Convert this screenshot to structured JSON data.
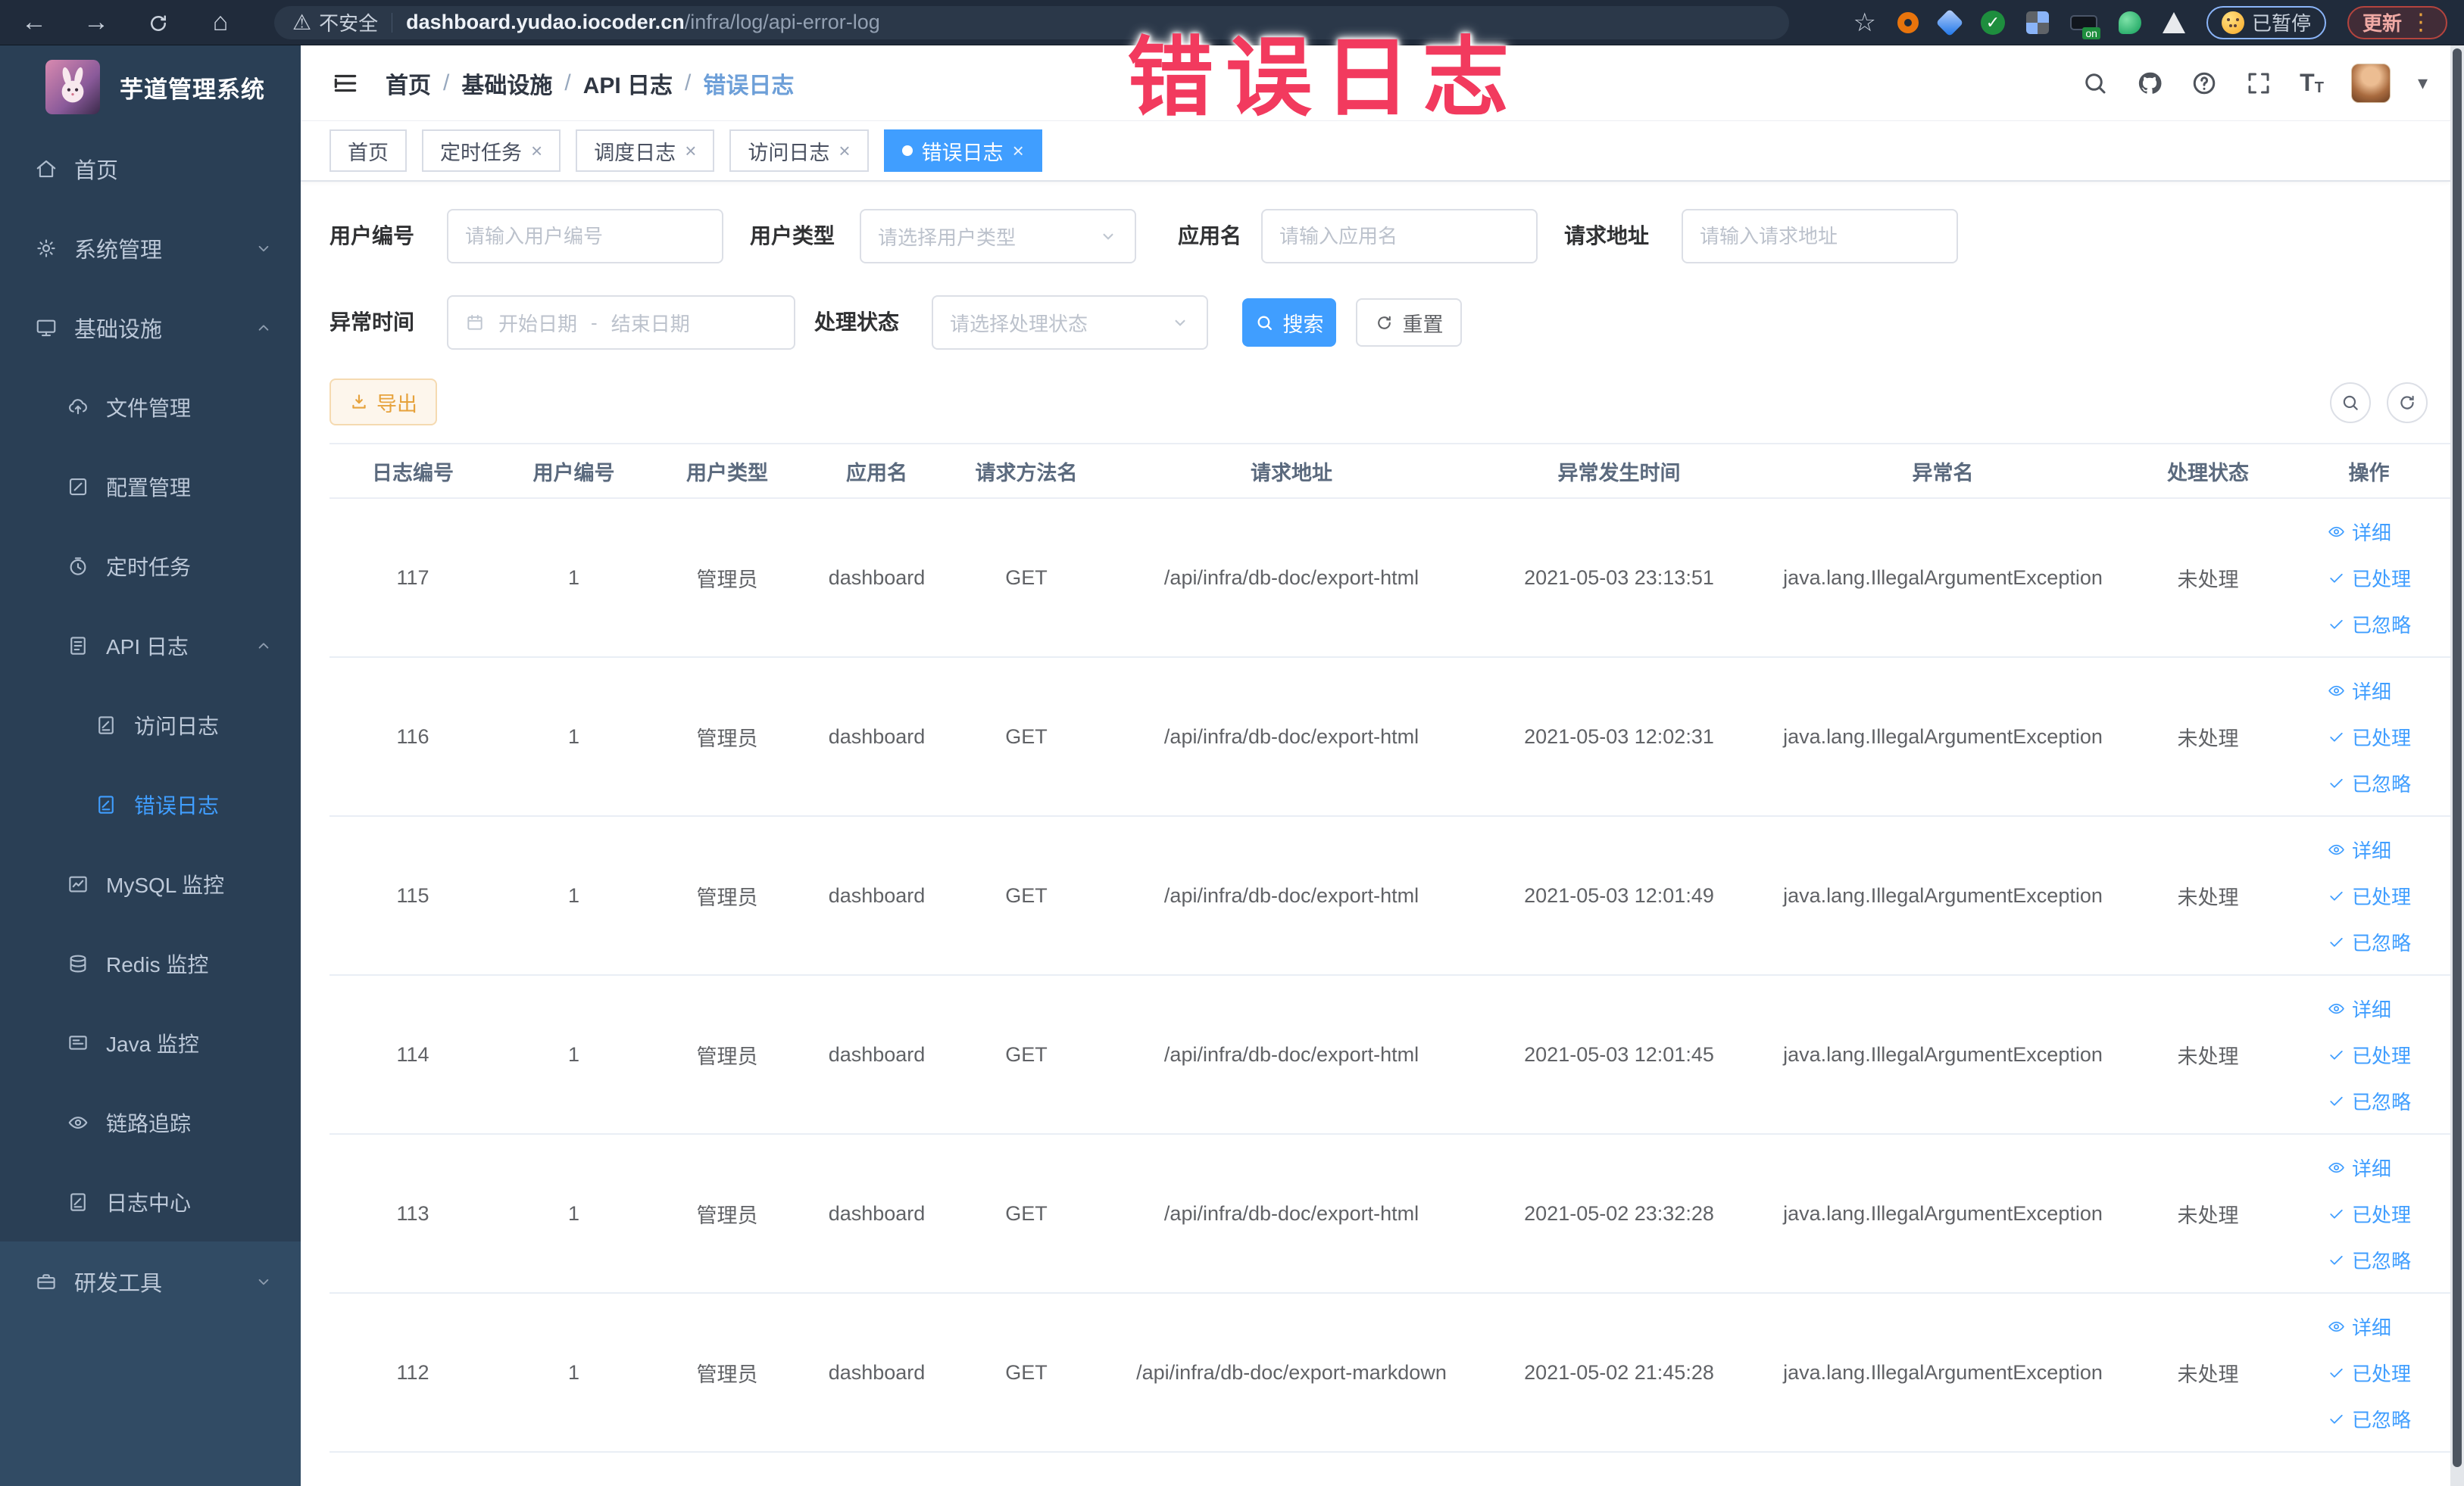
{
  "colors": {
    "accent": "#409eff",
    "warning": "#e6a23c",
    "overlay": "#f23a5e",
    "sidebar_bg": "#2a3f55",
    "active_tab_bg": "#409eff"
  },
  "overlay_title": "错误日志",
  "browser": {
    "security_label": "不安全",
    "url_host": "dashboard.yudao.iocoder.cn",
    "url_path": "/infra/log/api-error-log",
    "ext_on_label": "on",
    "paused_badge": "已暂停",
    "update_label": "更新"
  },
  "sidebar": {
    "title": "芋道管理系统",
    "items": [
      {
        "key": "home",
        "label": "首页",
        "icon": "home",
        "level": 0
      },
      {
        "key": "system-management",
        "label": "系统管理",
        "icon": "gear",
        "level": 0,
        "chevron": "down"
      },
      {
        "key": "infrastructure",
        "label": "基础设施",
        "icon": "monitor",
        "level": 0,
        "chevron": "up"
      },
      {
        "key": "file-management",
        "label": "文件管理",
        "icon": "cloud",
        "level": 1
      },
      {
        "key": "config-management",
        "label": "配置管理",
        "icon": "edit",
        "level": 1
      },
      {
        "key": "scheduled-jobs",
        "label": "定时任务",
        "icon": "timer",
        "level": 1
      },
      {
        "key": "api-log",
        "label": "API 日志",
        "icon": "doc",
        "level": 1,
        "chevron": "up"
      },
      {
        "key": "access-log",
        "label": "访问日志",
        "icon": "doc-edit",
        "level": 2
      },
      {
        "key": "error-log",
        "label": "错误日志",
        "icon": "doc-edit",
        "level": 2,
        "active": true
      },
      {
        "key": "mysql-monitor",
        "label": "MySQL 监控",
        "icon": "chart",
        "level": 1
      },
      {
        "key": "redis-monitor",
        "label": "Redis 监控",
        "icon": "db",
        "level": 1
      },
      {
        "key": "java-monitor",
        "label": "Java 监控",
        "icon": "screen",
        "level": 1
      },
      {
        "key": "trace",
        "label": "链路追踪",
        "icon": "eye",
        "level": 1
      },
      {
        "key": "log-center",
        "label": "日志中心",
        "icon": "doc-edit",
        "level": 1
      },
      {
        "key": "dev-tools",
        "label": "研发工具",
        "icon": "toolbox",
        "level": 0,
        "chevron": "down",
        "section": "dev"
      }
    ]
  },
  "header": {
    "breadcrumb": [
      "首页",
      "基础设施",
      "API 日志",
      "错误日志"
    ]
  },
  "tabs": [
    {
      "key": "home",
      "label": "首页"
    },
    {
      "key": "job",
      "label": "定时任务",
      "closable": true
    },
    {
      "key": "job-log",
      "label": "调度日志",
      "closable": true
    },
    {
      "key": "access-log",
      "label": "访问日志",
      "closable": true
    },
    {
      "key": "error-log",
      "label": "错误日志",
      "closable": true,
      "active": true
    }
  ],
  "filters": {
    "user_id_label": "用户编号",
    "user_id_placeholder": "请输入用户编号",
    "user_type_label": "用户类型",
    "user_type_placeholder": "请选择用户类型",
    "app_name_label": "应用名",
    "app_name_placeholder": "请输入应用名",
    "request_url_label": "请求地址",
    "request_url_placeholder": "请输入请求地址",
    "exception_time_label": "异常时间",
    "date_start_placeholder": "开始日期",
    "range_separator": "-",
    "date_end_placeholder": "结束日期",
    "process_status_label": "处理状态",
    "process_status_placeholder": "请选择处理状态",
    "search_label": "搜索",
    "reset_label": "重置"
  },
  "toolbar": {
    "export_label": "导出"
  },
  "table": {
    "columns": [
      "日志编号",
      "用户编号",
      "用户类型",
      "应用名",
      "请求方法名",
      "请求地址",
      "异常发生时间",
      "异常名",
      "处理状态",
      "操作"
    ],
    "action_labels": [
      "详细",
      "已处理",
      "已忽略"
    ],
    "rows": [
      {
        "id": "117",
        "user_id": "1",
        "user_type": "管理员",
        "app_name": "dashboard",
        "method": "GET",
        "url": "/api/infra/db-doc/export-html",
        "time": "2021-05-03 23:13:51",
        "exception": "java.lang.IllegalArgumentException",
        "status": "未处理"
      },
      {
        "id": "116",
        "user_id": "1",
        "user_type": "管理员",
        "app_name": "dashboard",
        "method": "GET",
        "url": "/api/infra/db-doc/export-html",
        "time": "2021-05-03 12:02:31",
        "exception": "java.lang.IllegalArgumentException",
        "status": "未处理"
      },
      {
        "id": "115",
        "user_id": "1",
        "user_type": "管理员",
        "app_name": "dashboard",
        "method": "GET",
        "url": "/api/infra/db-doc/export-html",
        "time": "2021-05-03 12:01:49",
        "exception": "java.lang.IllegalArgumentException",
        "status": "未处理"
      },
      {
        "id": "114",
        "user_id": "1",
        "user_type": "管理员",
        "app_name": "dashboard",
        "method": "GET",
        "url": "/api/infra/db-doc/export-html",
        "time": "2021-05-03 12:01:45",
        "exception": "java.lang.IllegalArgumentException",
        "status": "未处理"
      },
      {
        "id": "113",
        "user_id": "1",
        "user_type": "管理员",
        "app_name": "dashboard",
        "method": "GET",
        "url": "/api/infra/db-doc/export-html",
        "time": "2021-05-02 23:32:28",
        "exception": "java.lang.IllegalArgumentException",
        "status": "未处理"
      },
      {
        "id": "112",
        "user_id": "1",
        "user_type": "管理员",
        "app_name": "dashboard",
        "method": "GET",
        "url": "/api/infra/db-doc/export-markdown",
        "time": "2021-05-02 21:45:28",
        "exception": "java.lang.IllegalArgumentException",
        "status": "未处理"
      }
    ]
  }
}
